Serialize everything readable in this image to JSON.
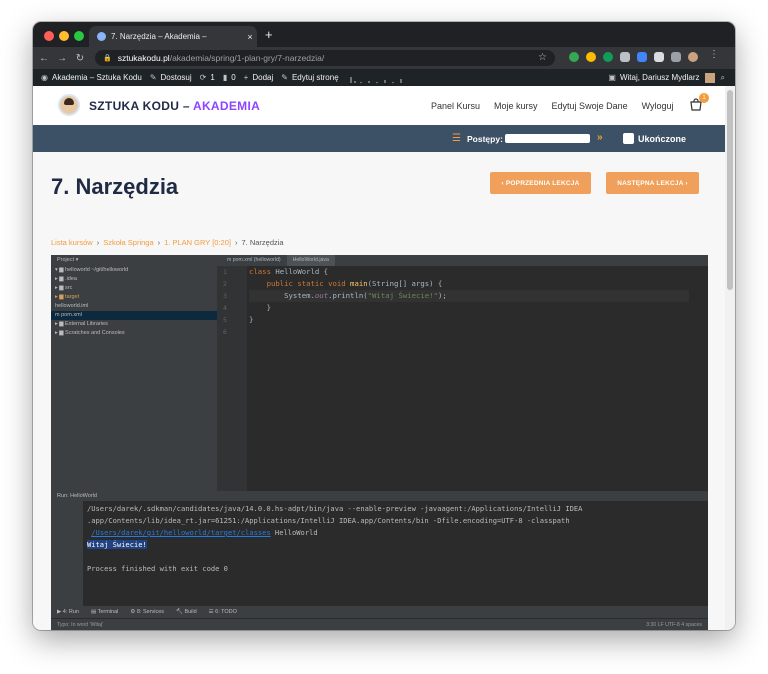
{
  "browser": {
    "tab_title": "7. Narzędzia – Akademia –",
    "tab_close": "×",
    "new_tab": "+",
    "url_host": "sztukakodu.pl",
    "url_path": "/akademia/spring/1-plan-gry/7-narzedzia/"
  },
  "wp_bar": {
    "site_name": "Akademia – Sztuka Kodu",
    "customize": "Dostosuj",
    "updates_count": "1",
    "comments_count": "0",
    "add_new": "Dodaj",
    "edit_page": "Edytuj stronę",
    "greeting": "Witaj, Dariusz Mydlarz"
  },
  "header": {
    "logo_main": "SZTUKA KODU – ",
    "logo_accent": "AKADEMIA",
    "nav": [
      "Panel Kursu",
      "Moje kursy",
      "Edytuj Swoje Dane",
      "Wyloguj"
    ],
    "cart_count": "1"
  },
  "progress": {
    "label": "Postępy:",
    "fraction": 0,
    "arrows": "»",
    "complete_label": "Ukończone"
  },
  "lesson": {
    "title": "7. Narzędzia",
    "prev_button": "‹   POPRZEDNIA LEKCJA",
    "next_button": "NASTĘPNA LEKCJA   ›",
    "breadcrumb": [
      "Lista kursów",
      "Szkoła Springa",
      "1. PLAN GRY [0:20]",
      "7. Narzędzia"
    ],
    "breadcrumb_sep": "›"
  },
  "ide": {
    "project_label": "Project ▾",
    "tabs": [
      "m pom.xml (helloworld)",
      "HelloWorld.java"
    ],
    "tree": [
      "▾ ▆ helloworld  ~/git/helloworld",
      "   ▸ ▆ .idea",
      "   ▸ ▆ src",
      "   ▸ ▆ target",
      "      helloworld.iml",
      "      m pom.xml",
      "▸ ▆ External Libraries",
      "▸ ▆ Scratches and Consoles"
    ],
    "line_numbers": [
      "1",
      "2",
      "3",
      "4",
      "5",
      "6"
    ],
    "code": {
      "l1_kw": "class",
      "l1_rest": " HelloWorld {",
      "l2_kw": "    public static void",
      "l2_fn": " main",
      "l2_rest": "(String[] args) {",
      "l3_pre": "        System.",
      "l3_fld": "out",
      "l3_mid": ".println(",
      "l3_str": "\"Witaj Świecie!\"",
      "l3_end": ");",
      "l4": "    }",
      "l5": "}"
    },
    "run_header": "Run:   HelloWorld",
    "output": [
      "/Users/darek/.sdkman/candidates/java/14.0.0.hs-adpt/bin/java --enable-preview -javaagent:/Applications/IntelliJ IDEA",
      " .app/Contents/lib/idea_rt.jar=61251:/Applications/IntelliJ IDEA.app/Contents/bin -Dfile.encoding=UTF-8 -classpath"
    ],
    "output_link": "/Users/darek/git/helloworld/target/classes",
    "output_link_rest": " HelloWorld",
    "output_selected": "Witaj Świecie!",
    "output_exit": "Process finished with exit code 0",
    "bottom_tabs": [
      "▶ 4: Run",
      "▤ Terminal",
      "⚙ 8: Services",
      "🔨 Build",
      "☰ 6: TODO"
    ],
    "status_left": "Typo: In word 'Witaj'",
    "status_right": "3:30   LF   UTF-8   4 spaces"
  },
  "colors": {
    "accent_purple": "#8e44ff",
    "orange": "#f39c3c",
    "progress_bg": "#3d5166"
  }
}
